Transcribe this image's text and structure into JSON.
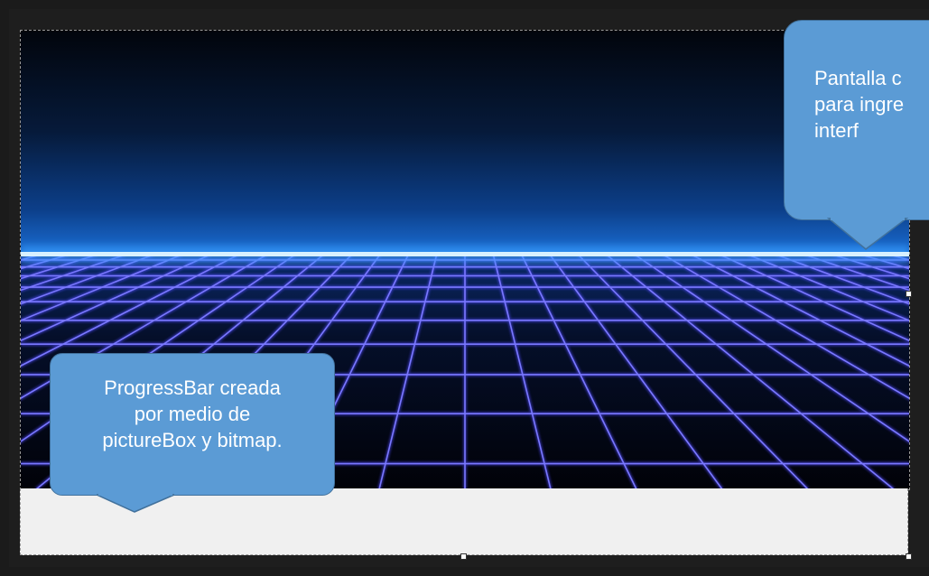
{
  "callouts": {
    "progress": {
      "text": "ProgressBar creada\npor medio de\npictureBox y bitmap."
    },
    "screen": {
      "text": "Pantalla c\npara ingre\ninterf"
    }
  },
  "colors": {
    "callout_fill": "#5b9bd5",
    "callout_border": "#41719c",
    "horizon_glow": "#3aa0ff",
    "grid_line": "#5a55ff",
    "progress_bg": "#f0f0f0"
  }
}
